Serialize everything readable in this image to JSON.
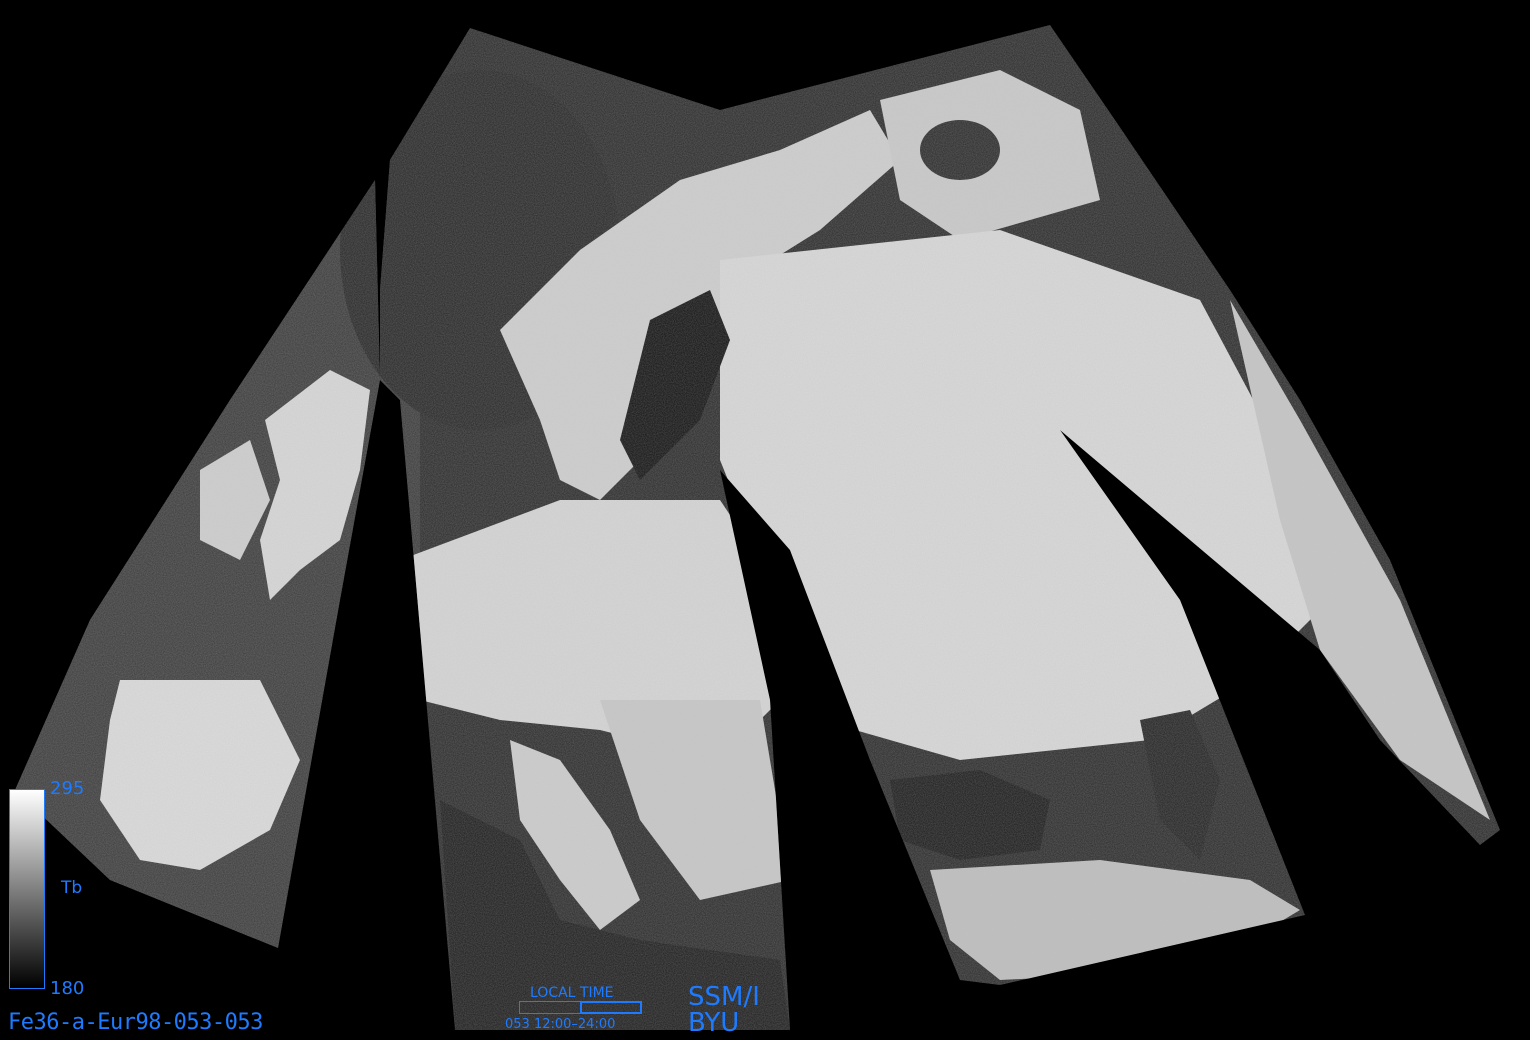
{
  "image_id": "Fe36-a-Eur98-053-053",
  "colorbar": {
    "max": "295",
    "min": "180",
    "label": "Tb"
  },
  "local_time": {
    "title": "LOCAL TIME",
    "range": "053  12:00–24:00",
    "fraction_start": 0.5,
    "fraction_end": 1.0
  },
  "sensor": "SSM/I",
  "organization": "BYU",
  "colors": {
    "annotation": "#1e7bff",
    "background": "#000000"
  }
}
